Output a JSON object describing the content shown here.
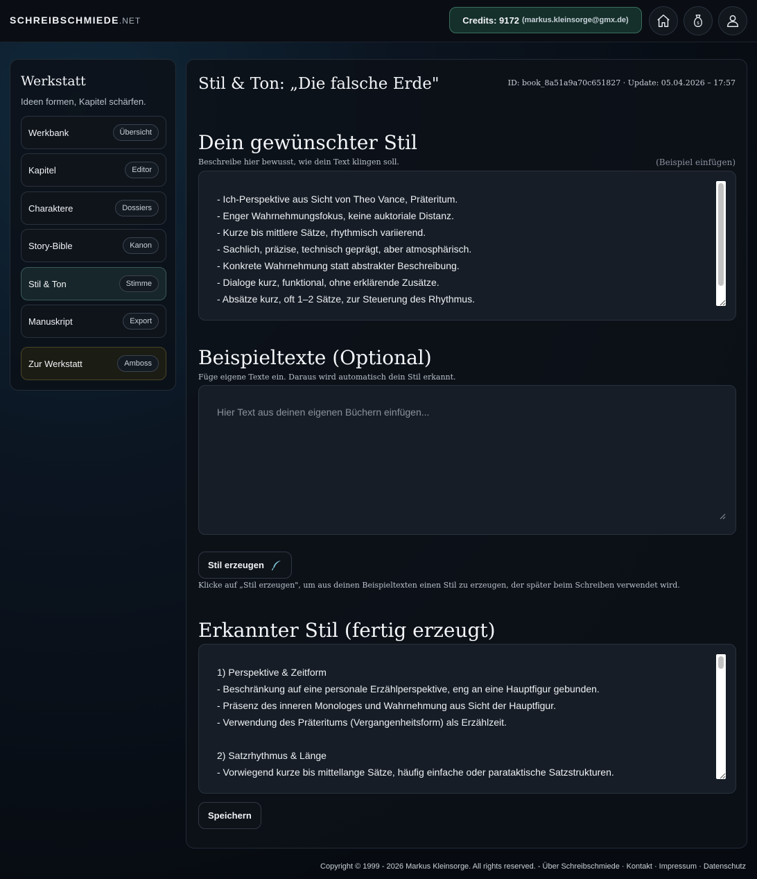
{
  "header": {
    "logo": "SCHREIBSCHMIEDE",
    "logo_tld": ".NET",
    "credits_label": "Credits: 9172",
    "credits_email": "(markus.kleinsorge@gmx.de)",
    "icons": [
      "home-icon",
      "money-bag-icon",
      "user-icon"
    ]
  },
  "sidebar": {
    "title": "Werkstatt",
    "subtitle": "Ideen formen, Kapitel schärfen.",
    "items": [
      {
        "label": "Werkbank",
        "badge": "Übersicht"
      },
      {
        "label": "Kapitel",
        "badge": "Editor"
      },
      {
        "label": "Charaktere",
        "badge": "Dossiers"
      },
      {
        "label": "Story-Bible",
        "badge": "Kanon"
      },
      {
        "label": "Stil & Ton",
        "badge": "Stimme"
      },
      {
        "label": "Manuskript",
        "badge": "Export"
      },
      {
        "label": "Zur Werkstatt",
        "badge": "Amboss"
      }
    ],
    "active_index": 4
  },
  "main": {
    "title": "Stil & Ton: „Die falsche Erde\"",
    "meta": "ID: book_8a51a9a70c651827 · Update: 05.04.2026 – 17:57",
    "style_section": {
      "heading": "Dein gewünschter Stil",
      "description": "Beschreibe hier bewusst, wie dein Text klingen soll.",
      "example_link": "(Beispiel einfügen)",
      "lines": [
        "- Ich-Perspektive aus Sicht von Theo Vance, Präteritum.",
        "- Enger Wahrnehmungsfokus, keine auktoriale Distanz.",
        "- Kurze bis mittlere Sätze, rhythmisch variierend.",
        "- Sachlich, präzise, technisch geprägt, aber atmosphärisch.",
        "- Konkrete Wahrnehmung statt abstrakter Beschreibung.",
        "- Dialoge kurz, funktional, ohne erklärende Zusätze.",
        "- Absätze kurz, oft 1–2 Sätze, zur Steuerung des Rhythmus."
      ]
    },
    "examples_section": {
      "heading": "Beispieltexte (Optional)",
      "description": "Füge eigene Texte ein. Daraus wird automatisch dein Stil erkannt.",
      "placeholder": "Hier Text aus deinen eigenen Büchern einfügen...",
      "value": ""
    },
    "generate": {
      "button_label": "Stil erzeugen",
      "icon": "quill-icon",
      "hint": "Klicke auf „Stil erzeugen\", um aus deinen Beispieltexten einen Stil zu erzeugen, der später beim Schreiben verwendet wird."
    },
    "detected_section": {
      "heading": "Erkannter Stil (fertig erzeugt)",
      "lines": [
        "1) Perspektive & Zeitform",
        "- Beschränkung auf eine personale Erzählperspektive, eng an eine Hauptfigur gebunden.",
        "- Präsenz des inneren Monologes und Wahrnehmung aus Sicht der Hauptfigur.",
        "- Verwendung des Präteritums (Vergangenheitsform) als Erzählzeit.",
        "",
        "2) Satzrhythmus & Länge",
        "- Vorwiegend kurze bis mittellange Sätze, häufig einfache oder parataktische Satzstrukturen."
      ]
    },
    "save_label": "Speichern"
  },
  "footer": {
    "text": "Copyright © 1999 - 2026 Markus Kleinsorge. All rights reserved. - Über Schreibschmiede · Kontakt · Impressum · Datenschutz"
  },
  "colors": {
    "credits_bg": "#15302a",
    "credits_border": "#3c6e5e",
    "active_nav_bg": "#17262a",
    "gold_nav_border": "#4a4626"
  }
}
